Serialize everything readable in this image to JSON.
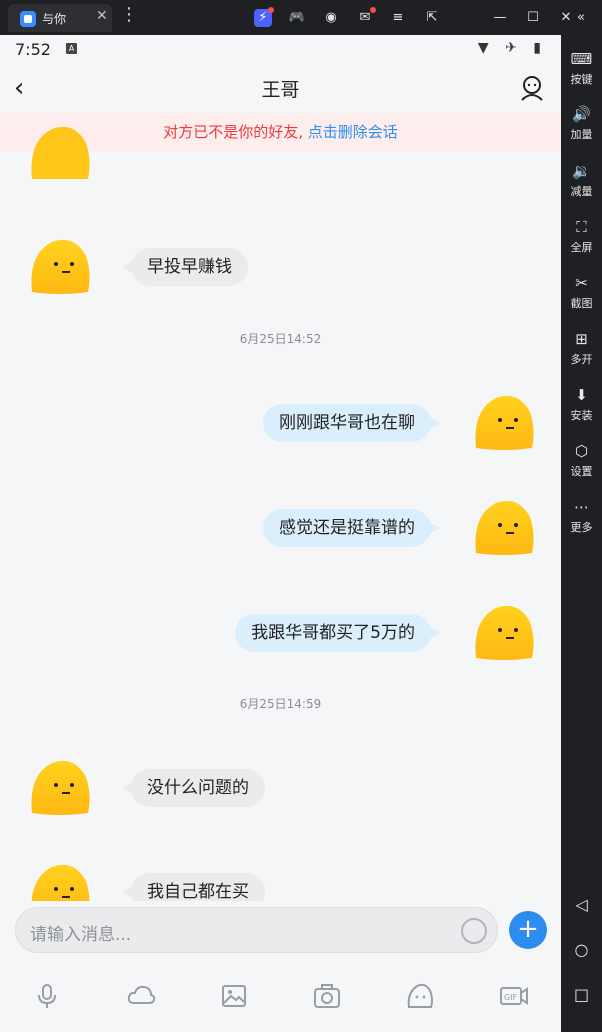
{
  "emulator": {
    "tab_title": "与你",
    "tab_close": "✕",
    "menu_glyph": "⋮",
    "top_icons": [
      "lightning-icon",
      "gamepad-icon",
      "user-icon",
      "mail-icon",
      "menu-icon",
      "export-icon",
      "minimize-icon",
      "maximize-icon",
      "close-icon",
      "collapse-icon"
    ],
    "top_glyphs": [
      "⚡",
      "🎮",
      "◉",
      "✉",
      "≡",
      "⇱",
      "—",
      "☐",
      "✕",
      "«"
    ],
    "side_buttons": [
      {
        "glyph": "⌨",
        "label": "按键"
      },
      {
        "glyph": "🔊",
        "label": "加量"
      },
      {
        "glyph": "🔉",
        "label": "减量"
      },
      {
        "glyph": "⛶",
        "label": "全屏"
      },
      {
        "glyph": "✂",
        "label": "截图"
      },
      {
        "glyph": "⊞",
        "label": "多开"
      },
      {
        "glyph": "⬇",
        "label": "安装"
      },
      {
        "glyph": "⬡",
        "label": "设置"
      },
      {
        "glyph": "⋯",
        "label": "更多"
      }
    ],
    "nav_glyphs": [
      "◁",
      "○",
      "□"
    ]
  },
  "status": {
    "time": "7:52",
    "badge": "A",
    "icons": "▼ ✈ ▮"
  },
  "header": {
    "back": "‹",
    "title": "王哥"
  },
  "banner": {
    "text": "对方已不是你的好友, ",
    "link": "点击删除会话"
  },
  "messages": [
    {
      "side": "in",
      "text": "早投早赚钱"
    },
    {
      "side": "ts",
      "text": "6月25日14:52"
    },
    {
      "side": "out",
      "text": "刚刚跟华哥也在聊"
    },
    {
      "side": "out",
      "text": "感觉还是挺靠谱的"
    },
    {
      "side": "out",
      "text": "我跟华哥都买了5万的"
    },
    {
      "side": "ts",
      "text": "6月25日14:59"
    },
    {
      "side": "in",
      "text": "没什么问题的"
    },
    {
      "side": "in",
      "text": "我自己都在买"
    }
  ],
  "input": {
    "placeholder": "请输入消息...",
    "plus": "+"
  },
  "toolbar": [
    "microphone-icon",
    "cloud-icon",
    "image-icon",
    "camera-icon",
    "emoji-icon",
    "gif-video-icon"
  ],
  "colors": {
    "accent": "#2d8cf0",
    "warning": "#f0393a",
    "bubble_out": "#dbeefc",
    "bubble_in": "#ebebec",
    "avatar_yellow": "#ffc61a"
  }
}
